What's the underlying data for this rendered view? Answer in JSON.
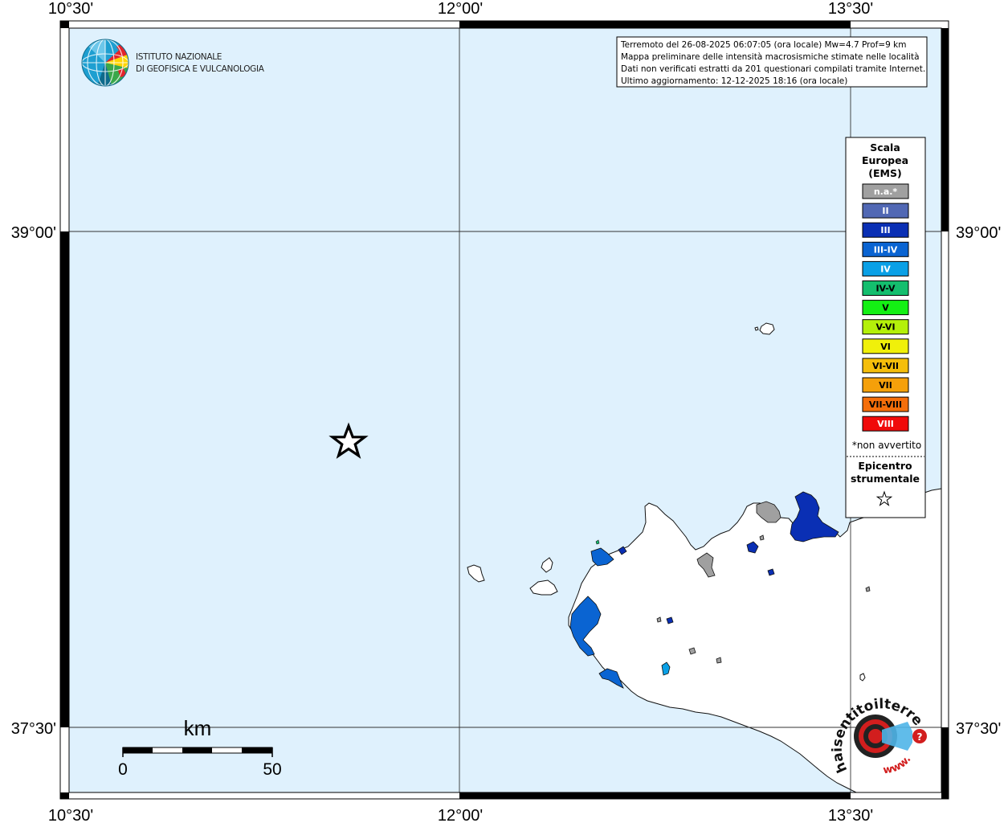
{
  "map": {
    "lon_labels": [
      "10°30'",
      "12°00'",
      "13°30'"
    ],
    "lat_labels": [
      "39°00'",
      "37°30'"
    ]
  },
  "logo": {
    "line1": "ISTITUTO NAZIONALE",
    "line2": "DI GEOFISICA E VULCANOLOGIA"
  },
  "info": {
    "lines": [
      "Terremoto del 26-08-2025 06:07:05 (ora locale) Mw=4.7 Prof=9 km",
      "Mappa preliminare delle intensità macrosismiche stimate nelle località",
      "Dati non verificati estratti da 201 questionari compilati tramite Internet.",
      "Ultimo aggiornamento: 12-12-2025 18:16 (ora locale)"
    ]
  },
  "legend": {
    "title": [
      "Scala",
      "Europea",
      "(EMS)"
    ],
    "classes": [
      {
        "label": "n.a.*",
        "color": "#a0a0a0",
        "text_color": "#ffffff"
      },
      {
        "label": "II",
        "color": "#5168b4",
        "text_color": "#ffffff"
      },
      {
        "label": "III",
        "color": "#0a2fb4",
        "text_color": "#ffffff"
      },
      {
        "label": "III-IV",
        "color": "#0a64d2",
        "text_color": "#ffffff"
      },
      {
        "label": "IV",
        "color": "#0aa0e6",
        "text_color": "#ffffff"
      },
      {
        "label": "IV-V",
        "color": "#14be6e",
        "text_color": "#000000"
      },
      {
        "label": "V",
        "color": "#14f014",
        "text_color": "#000000"
      },
      {
        "label": "V-VI",
        "color": "#b4f00a",
        "text_color": "#000000"
      },
      {
        "label": "VI",
        "color": "#f0f00a",
        "text_color": "#000000"
      },
      {
        "label": "VI-VII",
        "color": "#f5be0a",
        "text_color": "#000000"
      },
      {
        "label": "VII",
        "color": "#f5a00a",
        "text_color": "#000000"
      },
      {
        "label": "VII-VIII",
        "color": "#f56e0a",
        "text_color": "#000000"
      },
      {
        "label": "VIII",
        "color": "#f00a0a",
        "text_color": "#ffffff"
      }
    ],
    "note": "*non avvertito",
    "epicenter_label": [
      "Epicentro",
      "strumentale"
    ]
  },
  "scale_bar": {
    "unit": "km",
    "min_label": "0",
    "max_label": "50"
  },
  "hsit_logo": {
    "text": "haisentitoilterremoto.it",
    "www": "www."
  },
  "colors": {
    "sea": "#dff1fd",
    "land": "#ffffff",
    "not_felt": "#a0a0a0",
    "intensity_III": "#0a2fb4",
    "intensity_III_IV": "#0a64d2",
    "intensity_IV": "#0aa0e6"
  }
}
